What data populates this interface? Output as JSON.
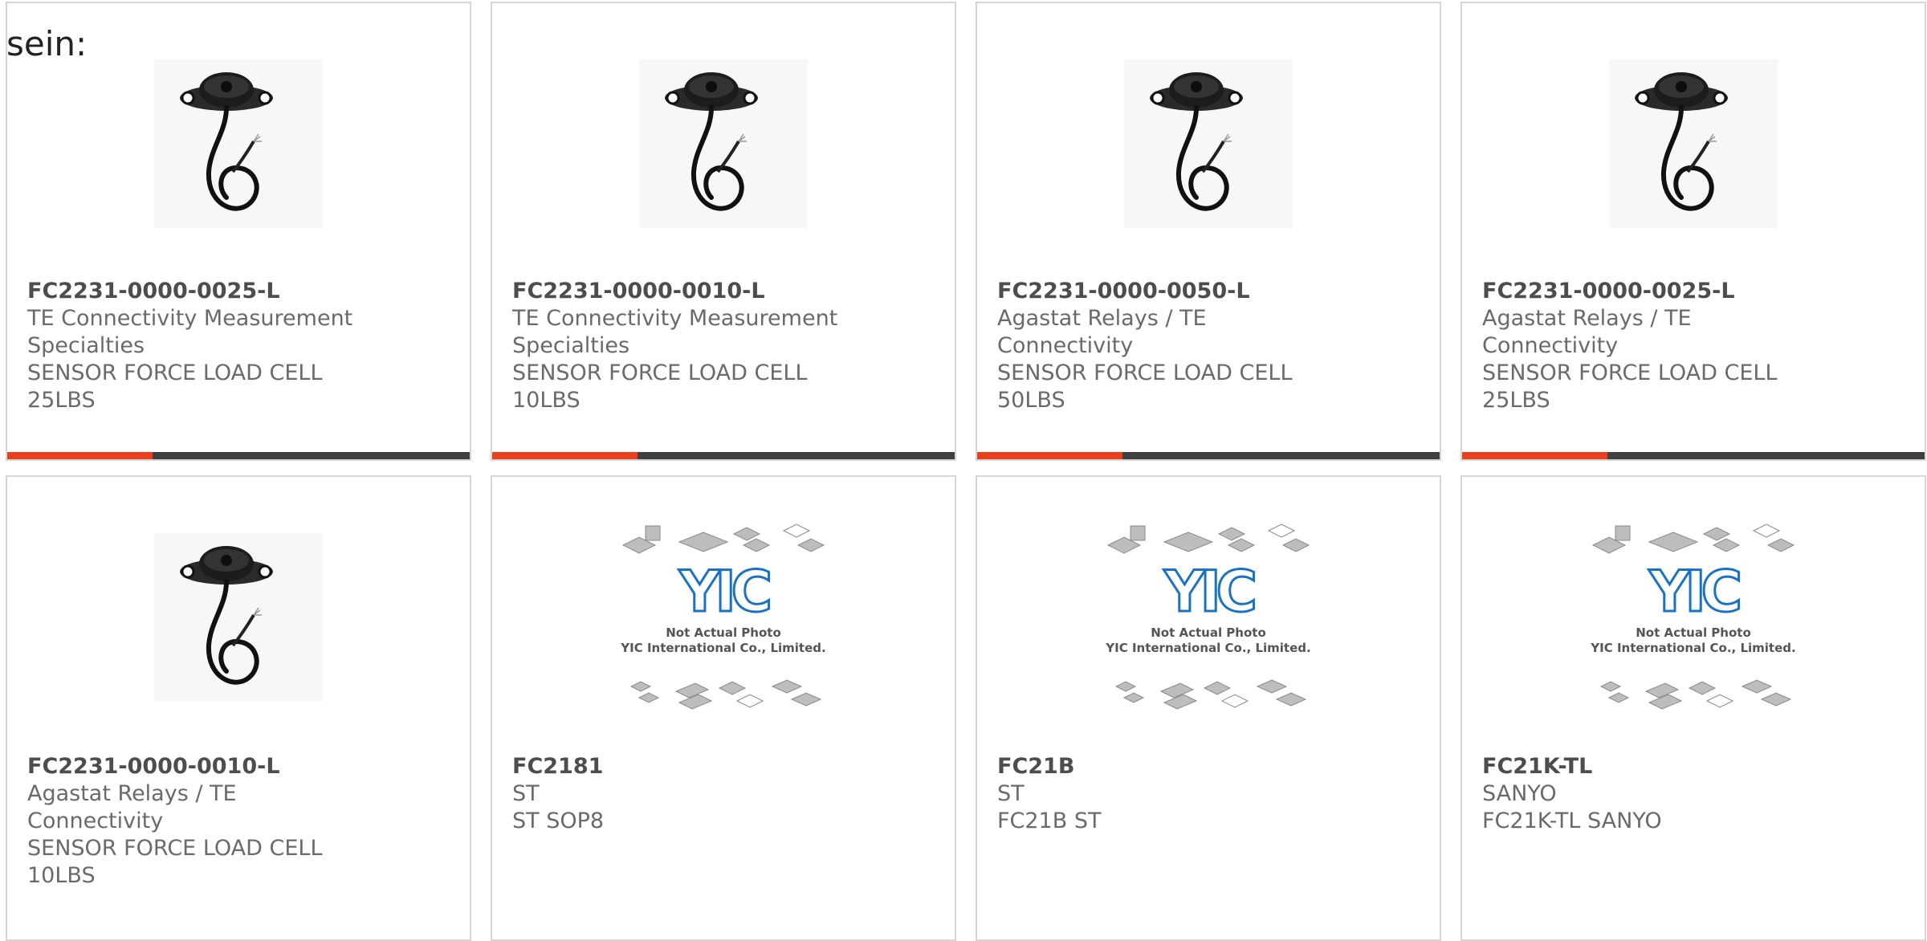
{
  "page": {
    "heading": "sein:"
  },
  "colors": {
    "accent": "#e8401c",
    "bar": "#404040",
    "card_border": "#d6d6d6",
    "text": "#6a6a6a",
    "placeholder_logo": "#1a72c4"
  },
  "products": [
    {
      "part_number": "FC2231-0000-0025-L",
      "manufacturer": "TE Connectivity Measurement Specialties",
      "description": "SENSOR FORCE LOAD CELL 25LBS",
      "image": "load-cell-sensor-photo"
    },
    {
      "part_number": "FC2231-0000-0010-L",
      "manufacturer": "TE Connectivity Measurement Specialties",
      "description": "SENSOR FORCE LOAD CELL 10LBS",
      "image": "load-cell-sensor-photo"
    },
    {
      "part_number": "FC2231-0000-0050-L",
      "manufacturer": "Agastat Relays / TE Connectivity",
      "description": "SENSOR FORCE LOAD CELL 50LBS",
      "image": "load-cell-sensor-photo"
    },
    {
      "part_number": "FC2231-0000-0025-L",
      "manufacturer": "Agastat Relays / TE Connectivity",
      "description": "SENSOR FORCE LOAD CELL 25LBS",
      "image": "load-cell-sensor-photo"
    },
    {
      "part_number": "FC2231-0000-0010-L",
      "manufacturer": "Agastat Relays / TE Connectivity",
      "description": "SENSOR FORCE LOAD CELL 10LBS",
      "image": "load-cell-sensor-photo"
    },
    {
      "part_number": "FC2181",
      "manufacturer": "ST",
      "description": "ST SOP8",
      "image": "not-actual-photo-placeholder",
      "placeholder": {
        "logo": "YIC",
        "line1": "Not Actual Photo",
        "line2": "YIC International Co., Limited."
      }
    },
    {
      "part_number": "FC21B",
      "manufacturer": "ST",
      "description": "FC21B ST",
      "image": "not-actual-photo-placeholder",
      "placeholder": {
        "logo": "YIC",
        "line1": "Not Actual Photo",
        "line2": "YIC International Co., Limited."
      }
    },
    {
      "part_number": "FC21K-TL",
      "manufacturer": "SANYO",
      "description": "FC21K-TL SANYO",
      "image": "not-actual-photo-placeholder",
      "placeholder": {
        "logo": "YIC",
        "line1": "Not Actual Photo",
        "line2": "YIC International Co., Limited."
      }
    }
  ]
}
